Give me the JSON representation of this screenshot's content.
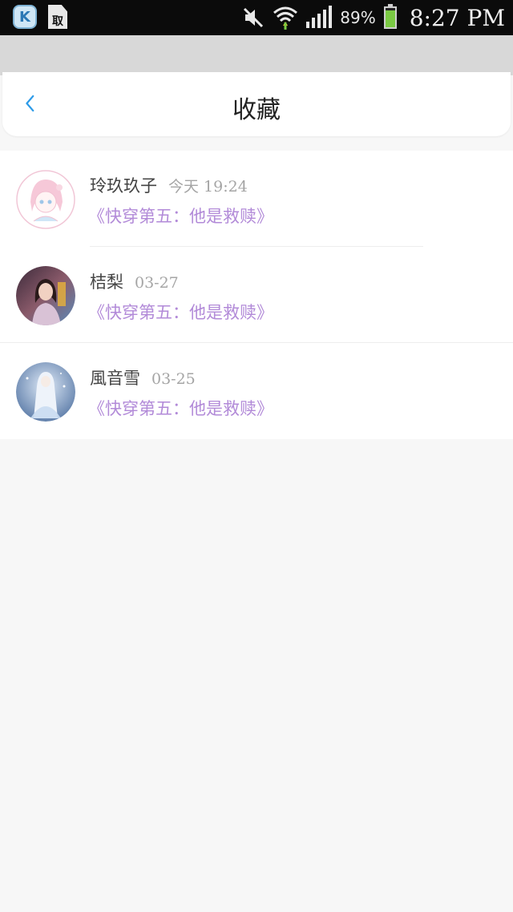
{
  "status_bar": {
    "left_icons": [
      "k-app-icon",
      "document-icon"
    ],
    "doc_icon_text": "取",
    "battery_percent": "89%",
    "battery_level": 0.89,
    "time": "8:27 PM",
    "right_icons": [
      "mute-icon",
      "wifi-icon",
      "signal-icon",
      "battery-icon"
    ]
  },
  "header": {
    "title": "收藏",
    "back_icon": "chevron-left-icon",
    "accent_color": "#2d9be8"
  },
  "colors": {
    "work_link": "#b28ad8",
    "timestamp": "#a5a5a5",
    "background": "#f7f7f7"
  },
  "favorites": [
    {
      "name": "玲玖玖子",
      "time": "今天 19:24",
      "work": "《快穿第五：他是救赎》",
      "avatar": "anime-girl-avatar"
    },
    {
      "name": "桔梨",
      "time": "03-27",
      "work": "《快穿第五：他是救赎》",
      "avatar": "photo-girl-avatar"
    },
    {
      "name": "風音雪",
      "time": "03-25",
      "work": "《快穿第五：他是救赎》",
      "avatar": "anime-snow-avatar"
    }
  ]
}
